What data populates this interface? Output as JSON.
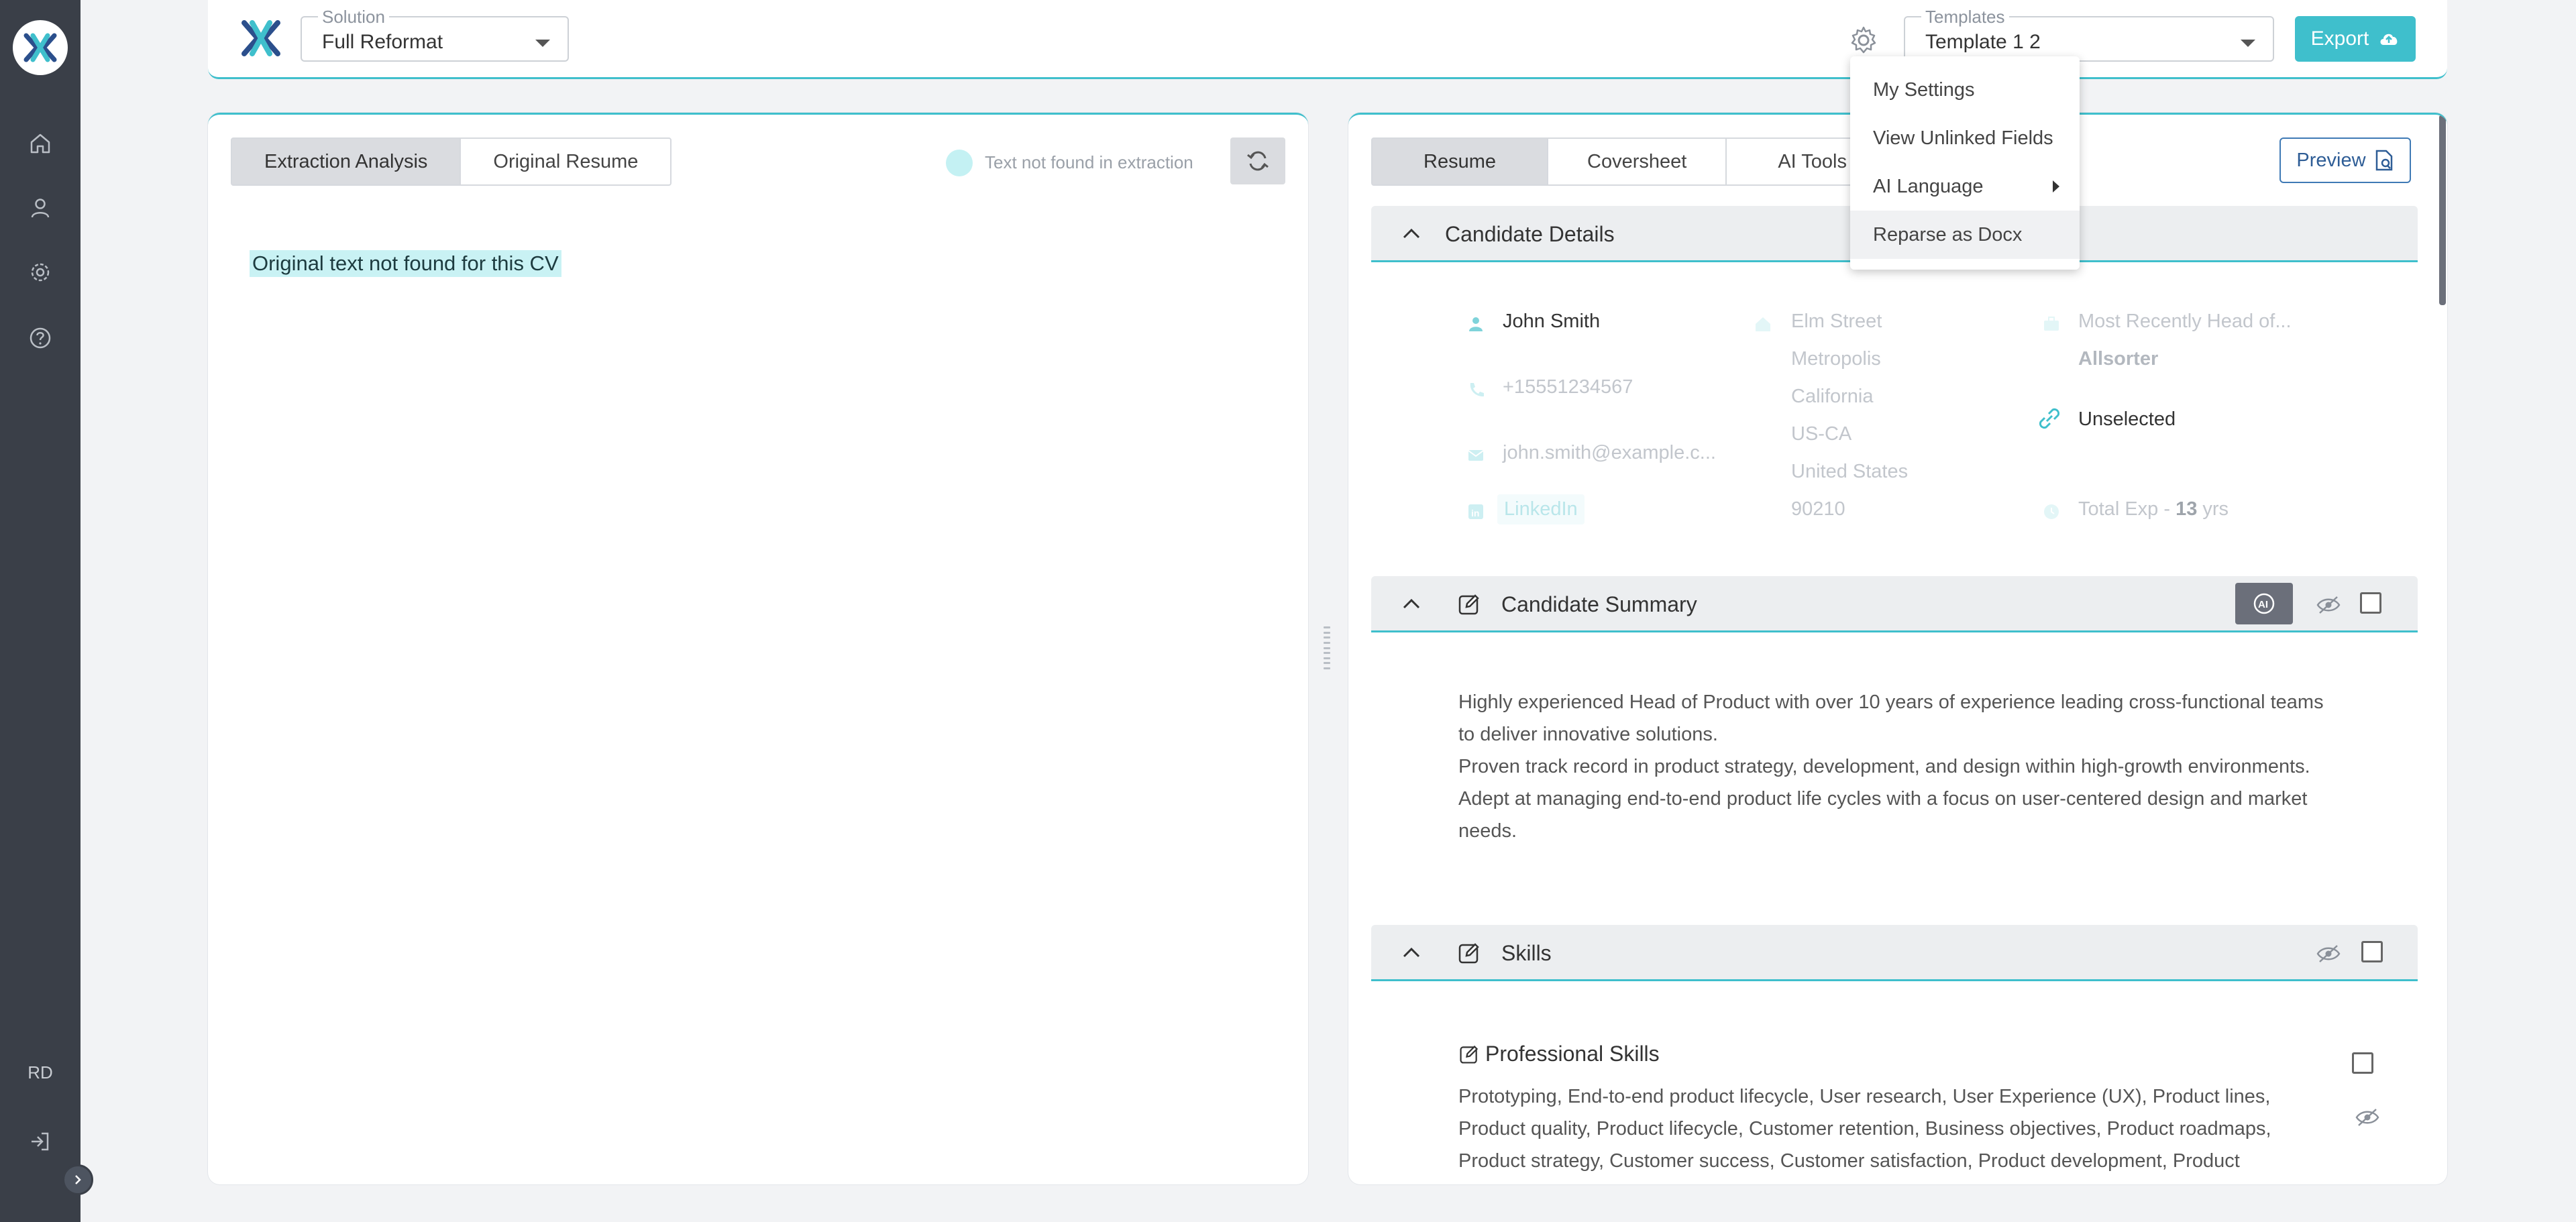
{
  "rail": {
    "initials": "RD",
    "items": [
      "home-icon",
      "user-icon",
      "gear-icon",
      "help-icon"
    ]
  },
  "topbar": {
    "solution": {
      "label": "Solution",
      "value": "Full Reformat"
    },
    "templates": {
      "label": "Templates",
      "value": "Template 1 2"
    },
    "export_label": "Export"
  },
  "settings_menu": {
    "items": [
      "My Settings",
      "View Unlinked Fields",
      "AI Language",
      "Reparse as Docx"
    ]
  },
  "left_panel": {
    "tabs": [
      "Extraction Analysis",
      "Original Resume"
    ],
    "legend_text": "Text not found in extraction",
    "not_found_text": "Original text not found for this CV"
  },
  "right_panel": {
    "tabs": [
      "Resume",
      "Coversheet",
      "AI Tools"
    ],
    "preview_label": "Preview",
    "candidate_details": {
      "title": "Candidate Details",
      "name": "John Smith",
      "phone": "+15551234567",
      "email": "john.smith@example.c...",
      "linkedin": "LinkedIn",
      "address": [
        "Elm Street",
        "Metropolis",
        "California",
        "US-CA",
        "United States",
        "90210"
      ],
      "recent_role": "Most Recently Head of...",
      "company": "Allsorter",
      "status": "Unselected",
      "total_exp_prefix": "Total Exp - ",
      "total_exp_value": "13",
      "total_exp_suffix": " yrs"
    },
    "summary": {
      "title": "Candidate Summary",
      "ai_label": "AI",
      "lines": [
        "Highly experienced Head of Product with over 10 years of experience leading cross-functional teams to deliver innovative solutions.",
        "Proven track record in product strategy, development, and design within high-growth environments.",
        "Adept at managing end-to-end product life cycles with a focus on user-centered design and market needs."
      ]
    },
    "skills": {
      "title": "Skills",
      "sub_title": "Professional Skills",
      "text": "Prototyping, End-to-end product lifecycle, User research, User Experience (UX), Product lines, Product quality, Product lifecycle, Customer retention, Business objectives, Product roadmaps, Product strategy, Customer success, Customer satisfaction, Product development, Product"
    }
  },
  "colors": {
    "accent": "#3fbfcc",
    "rail": "#3a3f48",
    "highlight": "#c9f2f4",
    "preview": "#2e5d96"
  }
}
